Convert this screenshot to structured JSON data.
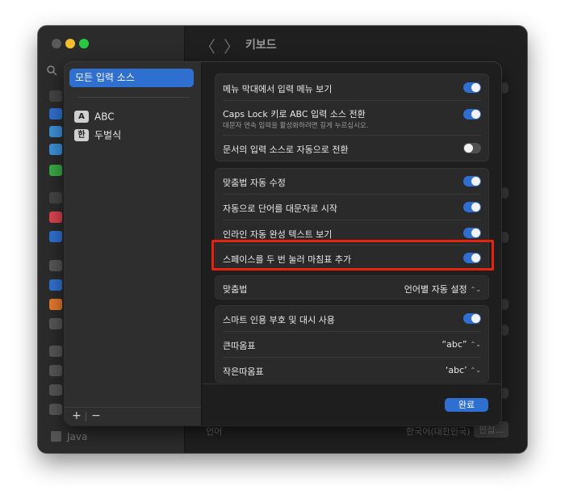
{
  "window": {
    "title": "키보드",
    "back_glyph": "〈",
    "forward_glyph": "〉"
  },
  "background": {
    "sidebar_bottom_label": "Java",
    "main_bottom_label": "언어",
    "main_bottom_value": "한국어(대한민국)",
    "main_bottom_button": "편집..."
  },
  "sheet": {
    "left": {
      "selected_item": "모든 입력 소스",
      "sources": [
        {
          "badge": "A",
          "label": "ABC"
        },
        {
          "badge": "한",
          "label": "두벌식"
        }
      ],
      "add_glyph": "+",
      "remove_glyph": "−"
    },
    "group1": {
      "rows": [
        {
          "label": "메뉴 막대에서 입력 메뉴 보기",
          "toggle": "on"
        },
        {
          "label": "Caps Lock 키로 ABC 입력 소스 전환",
          "sub": "대문자 연속 입력을 활성화하려면 길게 누르십시오.",
          "toggle": "on"
        },
        {
          "label": "문서의 입력 소스로 자동으로 전환",
          "toggle": "off"
        }
      ]
    },
    "group2": {
      "rows": [
        {
          "label": "맞춤법 자동 수정",
          "toggle": "on"
        },
        {
          "label": "자동으로 단어를 대문자로 시작",
          "toggle": "on"
        },
        {
          "label": "인라인 자동 완성 텍스트 보기",
          "toggle": "on"
        },
        {
          "label": "스페이스를 두 번 눌러 마침표 추가",
          "toggle": "on"
        }
      ]
    },
    "spelling": {
      "label": "맞춤법",
      "value": "언어별 자동 설정"
    },
    "group3": {
      "rows": [
        {
          "label": "스마트 인용 부호 및 대시 사용",
          "toggle": "on"
        },
        {
          "label": "큰따옴표",
          "value": "“abc”"
        },
        {
          "label": "작은따옴표",
          "value": "‘abc’"
        }
      ]
    },
    "done_label": "완료",
    "stepper_glyph": "⌃⌄"
  },
  "colors": {
    "accent": "#2f6fcf",
    "highlight": "#e8220d"
  }
}
